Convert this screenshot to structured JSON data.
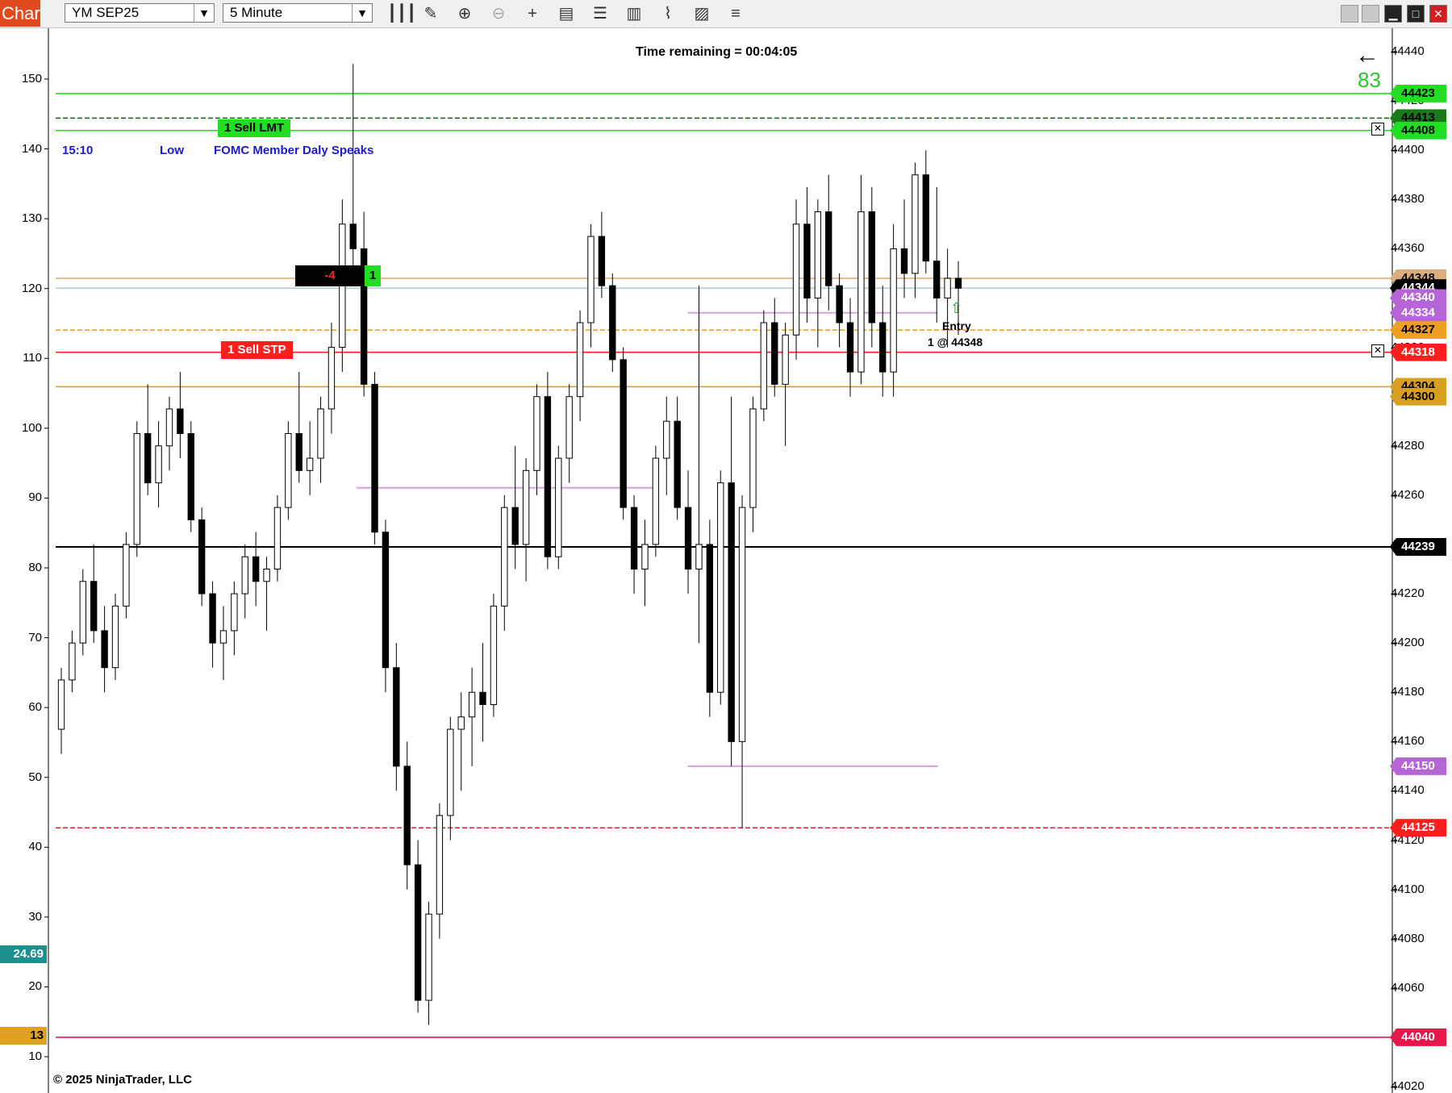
{
  "toolbar": {
    "tab_label": "Chart",
    "instrument": "YM SEP25",
    "interval": "5 Minute",
    "icons": [
      "bar-type-icon",
      "draw-pencil-icon",
      "zoom-in-icon",
      "zoom-out-icon",
      "crosshair-icon",
      "data-box-icon",
      "properties-icon",
      "strategies-icon",
      "indicators-icon",
      "chart-trader-icon"
    ]
  },
  "header": {
    "time_remaining": "Time remaining = 00:04:05"
  },
  "counter": {
    "arrow": "←",
    "value": "83"
  },
  "news": {
    "time": "15:10",
    "impact": "Low",
    "event": "FOMC Member Daly Speaks"
  },
  "orders": {
    "sell_lmt": {
      "label": "1 Sell LMT",
      "price": "44408",
      "color": "#22dd22"
    },
    "sell_stp": {
      "label": "1 Sell STP",
      "price": "44318",
      "color": "#ff1e1e"
    }
  },
  "position": {
    "pnl": "-4",
    "qty": "1"
  },
  "entry": {
    "title": "Entry",
    "detail": "1 @ 44348"
  },
  "copyright": "© 2025 NinjaTrader, LLC",
  "right_axis": [
    "44440",
    "44420",
    "44400",
    "44380",
    "44360",
    "44340",
    "44320",
    "44300",
    "44280",
    "44260",
    "44240",
    "44220",
    "44200",
    "44180",
    "44160",
    "44140",
    "44120",
    "44100",
    "44080",
    "44060",
    "44040",
    "44020"
  ],
  "left_axis": [
    "150",
    "140",
    "130",
    "120",
    "110",
    "100",
    "90",
    "80",
    "70",
    "60",
    "50",
    "40",
    "30",
    "20",
    "10"
  ],
  "price_tags": [
    {
      "value": "44423",
      "color": "#22dd22",
      "text": "#000"
    },
    {
      "value": "44413",
      "color": "#1a7a1a",
      "text": "#000"
    },
    {
      "value": "44408",
      "color": "#22dd22",
      "text": "#000"
    },
    {
      "value": "44348",
      "color": "#d9ad7c",
      "text": "#000"
    },
    {
      "value": "44344",
      "color": "#000000",
      "text": "#fff"
    },
    {
      "value": "44340",
      "color": "#b565d6",
      "text": "#fff"
    },
    {
      "value": "44334",
      "color": "#b565d6",
      "text": "#fff"
    },
    {
      "value": "44327",
      "color": "#f0a020",
      "text": "#000"
    },
    {
      "value": "44318",
      "color": "#ff1e1e",
      "text": "#fff"
    },
    {
      "value": "44304",
      "color": "#d8a020",
      "text": "#000"
    },
    {
      "value": "44300",
      "color": "#d8a020",
      "text": "#000"
    },
    {
      "value": "44239",
      "color": "#000000",
      "text": "#fff"
    },
    {
      "value": "44150",
      "color": "#b565d6",
      "text": "#fff"
    },
    {
      "value": "44125",
      "color": "#ff1e1e",
      "text": "#fff"
    },
    {
      "value": "44040",
      "color": "#e8174a",
      "text": "#fff"
    }
  ],
  "left_tags": [
    {
      "value": "24.69",
      "color": "#1e8f8f",
      "text": "#fff"
    },
    {
      "value": "13",
      "color": "#e0a020",
      "text": "#000"
    }
  ],
  "chart_data": {
    "type": "candlestick",
    "instrument": "YM SEP25",
    "interval": "5 Minute",
    "price_range": [
      44020,
      44440
    ],
    "oscillator_range": [
      10,
      150
    ],
    "horizontal_lines": [
      {
        "price": 44423,
        "color": "#22dd22",
        "style": "solid"
      },
      {
        "price": 44413,
        "color": "#1a6a1a",
        "style": "dashed"
      },
      {
        "price": 44408,
        "color": "#22dd22",
        "style": "solid"
      },
      {
        "price": 44348,
        "color": "#d9ad7c",
        "style": "solid"
      },
      {
        "price": 44344,
        "color": "#b0c8d8",
        "style": "solid"
      },
      {
        "price": 44327,
        "color": "#f0a020",
        "style": "dashed"
      },
      {
        "price": 44318,
        "color": "#ff1e1e",
        "style": "solid"
      },
      {
        "price": 44304,
        "color": "#d8a020",
        "style": "solid"
      },
      {
        "price": 44239,
        "color": "#000000",
        "style": "solid"
      },
      {
        "price": 44125,
        "color": "#e0202a",
        "style": "dashed"
      },
      {
        "price": 44040,
        "color": "#e8174a",
        "style": "solid"
      }
    ],
    "segments": [
      {
        "price": 44334,
        "x_start": 0.473,
        "x_end": 0.66,
        "color": "#d7a2dc"
      },
      {
        "price": 44263,
        "x_start": 0.225,
        "x_end": 0.45,
        "color": "#d7a2dc"
      },
      {
        "price": 44150,
        "x_start": 0.473,
        "x_end": 0.66,
        "color": "#d7a2dc"
      }
    ],
    "candles": [
      [
        44165,
        44190,
        44155,
        44185
      ],
      [
        44185,
        44205,
        44180,
        44200
      ],
      [
        44200,
        44230,
        44195,
        44225
      ],
      [
        44225,
        44240,
        44200,
        44205
      ],
      [
        44205,
        44215,
        44180,
        44190
      ],
      [
        44190,
        44220,
        44185,
        44215
      ],
      [
        44215,
        44245,
        44210,
        44240
      ],
      [
        44240,
        44290,
        44235,
        44285
      ],
      [
        44285,
        44305,
        44260,
        44265
      ],
      [
        44265,
        44290,
        44255,
        44280
      ],
      [
        44280,
        44300,
        44270,
        44295
      ],
      [
        44295,
        44310,
        44275,
        44285
      ],
      [
        44285,
        44290,
        44245,
        44250
      ],
      [
        44250,
        44255,
        44215,
        44220
      ],
      [
        44220,
        44225,
        44190,
        44200
      ],
      [
        44200,
        44215,
        44185,
        44205
      ],
      [
        44205,
        44225,
        44195,
        44220
      ],
      [
        44220,
        44240,
        44210,
        44235
      ],
      [
        44235,
        44245,
        44215,
        44225
      ],
      [
        44225,
        44235,
        44205,
        44230
      ],
      [
        44230,
        44260,
        44225,
        44255
      ],
      [
        44255,
        44290,
        44250,
        44285
      ],
      [
        44285,
        44310,
        44265,
        44270
      ],
      [
        44270,
        44290,
        44260,
        44275
      ],
      [
        44275,
        44300,
        44265,
        44295
      ],
      [
        44295,
        44330,
        44285,
        44320
      ],
      [
        44320,
        44380,
        44310,
        44370
      ],
      [
        44370,
        44435,
        44350,
        44360
      ],
      [
        44360,
        44375,
        44300,
        44305
      ],
      [
        44305,
        44310,
        44240,
        44245
      ],
      [
        44245,
        44250,
        44180,
        44190
      ],
      [
        44190,
        44200,
        44140,
        44150
      ],
      [
        44150,
        44160,
        44100,
        44110
      ],
      [
        44110,
        44120,
        44050,
        44055
      ],
      [
        44055,
        44095,
        44045,
        44090
      ],
      [
        44090,
        44135,
        44080,
        44130
      ],
      [
        44130,
        44170,
        44120,
        44165
      ],
      [
        44165,
        44180,
        44140,
        44170
      ],
      [
        44170,
        44190,
        44150,
        44180
      ],
      [
        44180,
        44200,
        44160,
        44175
      ],
      [
        44175,
        44220,
        44170,
        44215
      ],
      [
        44215,
        44260,
        44205,
        44255
      ],
      [
        44255,
        44280,
        44230,
        44240
      ],
      [
        44240,
        44275,
        44225,
        44270
      ],
      [
        44270,
        44305,
        44260,
        44300
      ],
      [
        44300,
        44310,
        44230,
        44235
      ],
      [
        44235,
        44280,
        44230,
        44275
      ],
      [
        44275,
        44305,
        44265,
        44300
      ],
      [
        44300,
        44335,
        44290,
        44330
      ],
      [
        44330,
        44370,
        44320,
        44365
      ],
      [
        44365,
        44375,
        44340,
        44345
      ],
      [
        44345,
        44350,
        44310,
        44315
      ],
      [
        44315,
        44320,
        44250,
        44255
      ],
      [
        44255,
        44260,
        44220,
        44230
      ],
      [
        44230,
        44250,
        44215,
        44240
      ],
      [
        44240,
        44280,
        44235,
        44275
      ],
      [
        44275,
        44300,
        44260,
        44290
      ],
      [
        44290,
        44300,
        44250,
        44255
      ],
      [
        44255,
        44270,
        44220,
        44230
      ],
      [
        44230,
        44345,
        44200,
        44240
      ],
      [
        44240,
        44250,
        44170,
        44180
      ],
      [
        44180,
        44270,
        44175,
        44265
      ],
      [
        44265,
        44300,
        44150,
        44160
      ],
      [
        44160,
        44260,
        44125,
        44255
      ],
      [
        44255,
        44300,
        44245,
        44295
      ],
      [
        44295,
        44335,
        44290,
        44330
      ],
      [
        44330,
        44340,
        44300,
        44305
      ],
      [
        44305,
        44330,
        44280,
        44325
      ],
      [
        44325,
        44380,
        44315,
        44370
      ],
      [
        44370,
        44385,
        44330,
        44340
      ],
      [
        44340,
        44380,
        44320,
        44375
      ],
      [
        44375,
        44390,
        44335,
        44345
      ],
      [
        44345,
        44350,
        44320,
        44330
      ],
      [
        44330,
        44340,
        44300,
        44310
      ],
      [
        44310,
        44390,
        44305,
        44375
      ],
      [
        44375,
        44385,
        44320,
        44330
      ],
      [
        44330,
        44345,
        44300,
        44310
      ],
      [
        44310,
        44370,
        44300,
        44360
      ],
      [
        44360,
        44380,
        44340,
        44350
      ],
      [
        44350,
        44395,
        44340,
        44390
      ],
      [
        44390,
        44400,
        44350,
        44355
      ],
      [
        44355,
        44385,
        44330,
        44340
      ],
      [
        44340,
        44360,
        44320,
        44348
      ],
      [
        44348,
        44355,
        44325,
        44344
      ]
    ]
  }
}
